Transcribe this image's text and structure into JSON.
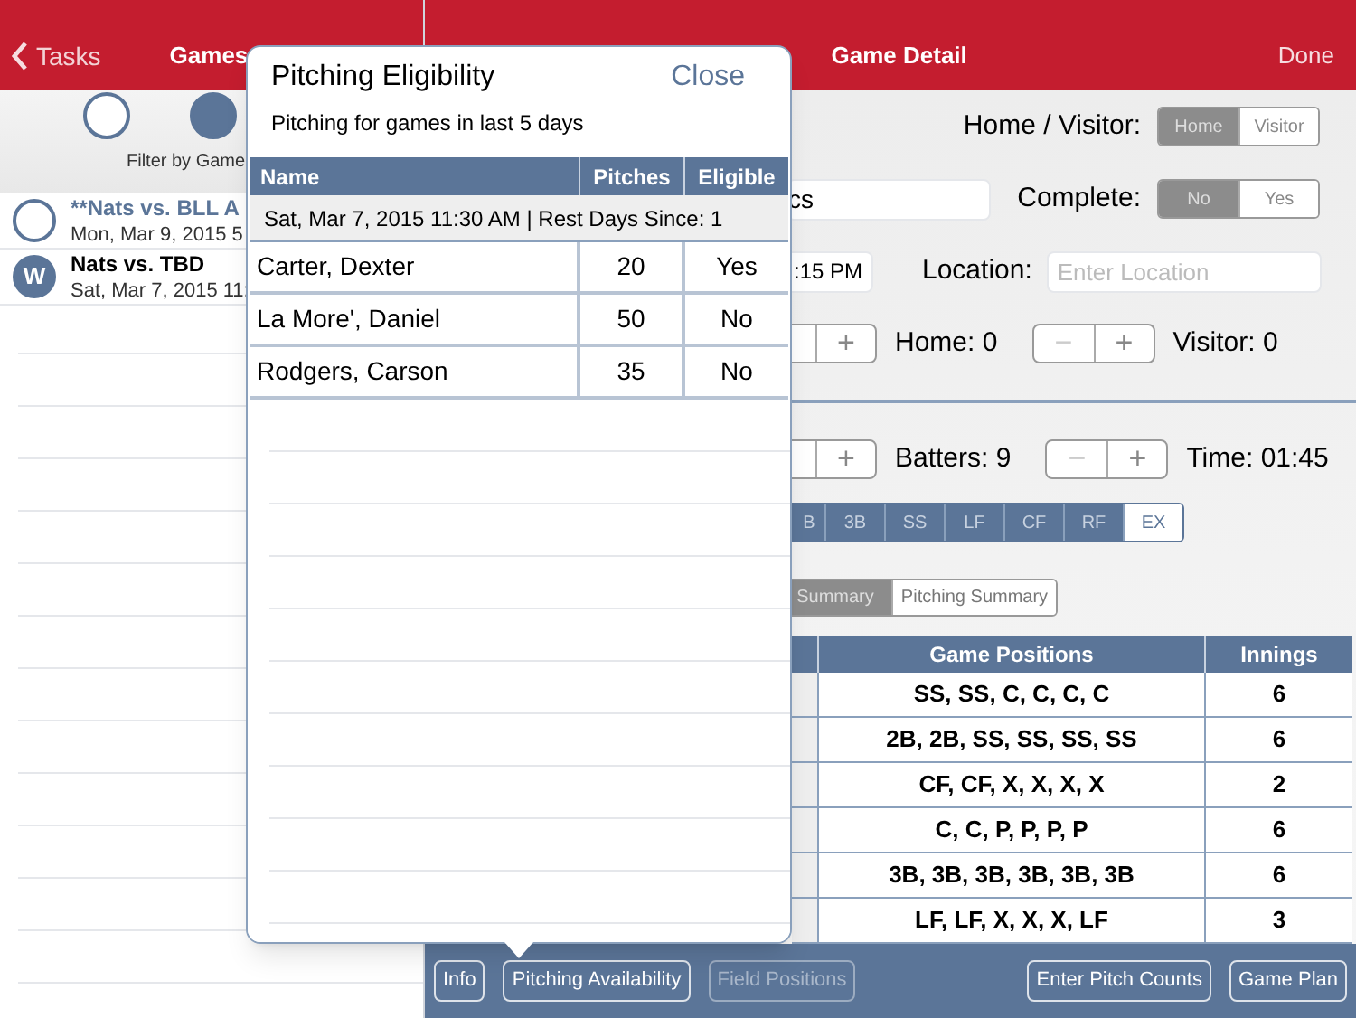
{
  "left_pane": {
    "back": "Tasks",
    "title": "Games",
    "filters": [
      {
        "selected": false
      },
      {
        "selected": true
      }
    ],
    "filter_label": "Filter by Game",
    "games": [
      {
        "kind": "upcoming",
        "title": "**Nats vs. BLL A",
        "date": "Mon, Mar 9, 2015 5"
      },
      {
        "kind": "played",
        "result": "W",
        "title": "Nats vs. TBD",
        "date": "Sat, Mar 7, 2015 11:"
      }
    ]
  },
  "detail": {
    "title": "Game Detail",
    "done": "Done",
    "home_visitor": {
      "label": "Home / Visitor:",
      "options": [
        {
          "label": "Home",
          "selected": true
        },
        {
          "label": "Visitor",
          "selected": false
        }
      ]
    },
    "game_name": "cs",
    "complete": {
      "label": "Complete:",
      "options": [
        {
          "label": "No",
          "selected": true
        },
        {
          "label": "Yes",
          "selected": false
        }
      ]
    },
    "time": ":15 PM",
    "location": {
      "label": "Location:",
      "placeholder": "Enter Location"
    },
    "score_row": [
      {
        "stepper": [
          "+"
        ],
        "label": "Home: 0"
      },
      {
        "stepper": [
          "−",
          "+"
        ],
        "label": "Visitor: 0"
      }
    ],
    "count_row": [
      {
        "stepper": [
          "+"
        ],
        "label": "Batters: 9"
      },
      {
        "stepper": [
          "−",
          "+"
        ],
        "label": "Time: 01:45"
      }
    ],
    "positions": [
      {
        "label": "B",
        "selected": true
      },
      {
        "label": "3B",
        "selected": true
      },
      {
        "label": "SS",
        "selected": true
      },
      {
        "label": "LF",
        "selected": true
      },
      {
        "label": "CF",
        "selected": true
      },
      {
        "label": "RF",
        "selected": true
      },
      {
        "label": "EX",
        "selected": false
      }
    ],
    "summary_tabs": [
      {
        "label": "Summary",
        "selected": true
      },
      {
        "label": "Pitching Summary",
        "selected": false
      }
    ],
    "table": {
      "columns": [
        "Game Positions",
        "Innings"
      ],
      "rows": [
        [
          "SS, SS, C, C, C, C",
          "6"
        ],
        [
          "2B, 2B, SS, SS, SS, SS",
          "6"
        ],
        [
          "CF, CF, X, X, X, X",
          "2"
        ],
        [
          "C, C, P, P, P, P",
          "6"
        ],
        [
          "3B, 3B, 3B, 3B, 3B, 3B",
          "6"
        ],
        [
          "LF, LF, X, X, X, LF",
          "3"
        ]
      ]
    }
  },
  "toolbar": {
    "left_buttons": [
      {
        "label": "Info",
        "disabled": false
      },
      {
        "label": "Pitching Availability",
        "disabled": false
      },
      {
        "label": "Field Positions",
        "disabled": true
      }
    ],
    "right_buttons": [
      {
        "label": "Enter Pitch Counts",
        "disabled": false
      },
      {
        "label": "Game Plan",
        "disabled": false
      }
    ]
  },
  "popover": {
    "title": "Pitching Eligibility",
    "close": "Close",
    "subtitle": "Pitching for games in last 5 days",
    "columns": [
      "Name",
      "Pitches",
      "Eligible"
    ],
    "section": "Sat, Mar 7, 2015 11:30 AM | Rest Days Since: 1",
    "rows": [
      [
        "Carter, Dexter",
        "20",
        "Yes"
      ],
      [
        "La More', Daniel",
        "50",
        "No"
      ],
      [
        "Rodgers, Carson",
        "35",
        "No"
      ]
    ]
  }
}
